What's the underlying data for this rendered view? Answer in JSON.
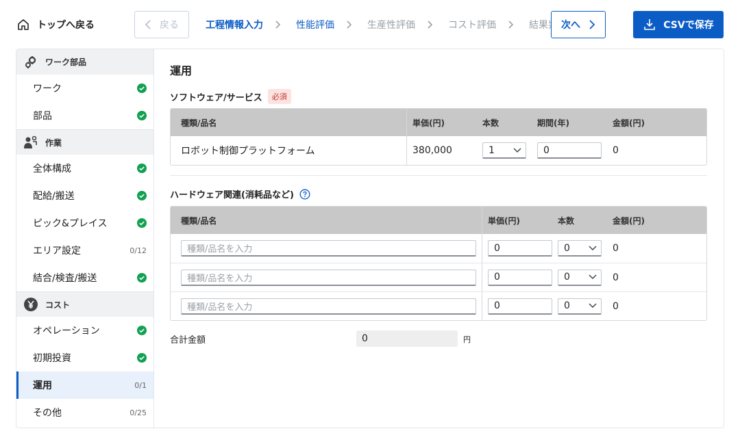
{
  "header": {
    "back_top_label": "トップへ戻る",
    "prev_label": "戻る",
    "next_label": "次へ",
    "csv_label": "CSVで保存",
    "steps": [
      {
        "label": "工程情報入力",
        "state": "active"
      },
      {
        "label": "性能評価",
        "state": "done"
      },
      {
        "label": "生産性評価",
        "state": "todo"
      },
      {
        "label": "コスト評価",
        "state": "todo"
      },
      {
        "label": "結果判定",
        "state": "todo"
      }
    ]
  },
  "sidebar": {
    "groups": [
      {
        "label": "ワーク部品",
        "icon": "gears-icon",
        "items": [
          {
            "label": "ワーク",
            "status": "check"
          },
          {
            "label": "部品",
            "status": "check"
          }
        ]
      },
      {
        "label": "作業",
        "icon": "worker-icon",
        "items": [
          {
            "label": "全体構成",
            "status": "check"
          },
          {
            "label": "配給/搬送",
            "status": "check"
          },
          {
            "label": "ピック&プレイス",
            "status": "check"
          },
          {
            "label": "エリア設定",
            "status": "0/12"
          },
          {
            "label": "結合/検査/搬送",
            "status": "check"
          }
        ]
      },
      {
        "label": "コスト",
        "icon": "yen-icon",
        "items": [
          {
            "label": "オペレーション",
            "status": "check"
          },
          {
            "label": "初期投資",
            "status": "check"
          },
          {
            "label": "運用",
            "status": "0/1",
            "selected": true
          },
          {
            "label": "その他",
            "status": "0/25"
          }
        ]
      }
    ]
  },
  "main": {
    "title": "運用",
    "software": {
      "label": "ソフトウェア/サービス",
      "required": "必須",
      "headers": [
        "種類/品名",
        "単価(円)",
        "本数",
        "期間(年)",
        "金額(円)"
      ],
      "row": {
        "name": "ロボット制御プラットフォーム",
        "price": "380,000",
        "qty": "1",
        "period": "0",
        "amount": "0"
      }
    },
    "hardware": {
      "label": "ハードウェア関連(消耗品など)",
      "headers": [
        "種類/品名",
        "単価(円)",
        "本数",
        "金額(円)"
      ],
      "placeholder": "種類/品名を入力",
      "rows": [
        {
          "price": "0",
          "qty": "0",
          "amount": "0"
        },
        {
          "price": "0",
          "qty": "0",
          "amount": "0"
        },
        {
          "price": "0",
          "qty": "0",
          "amount": "0"
        }
      ]
    },
    "total": {
      "label": "合計金額",
      "value": "0",
      "unit": "円"
    }
  },
  "colors": {
    "accent": "#0b5cc5",
    "check": "#12a150",
    "required_bg": "#fde2e2",
    "required_text": "#c0392b"
  }
}
